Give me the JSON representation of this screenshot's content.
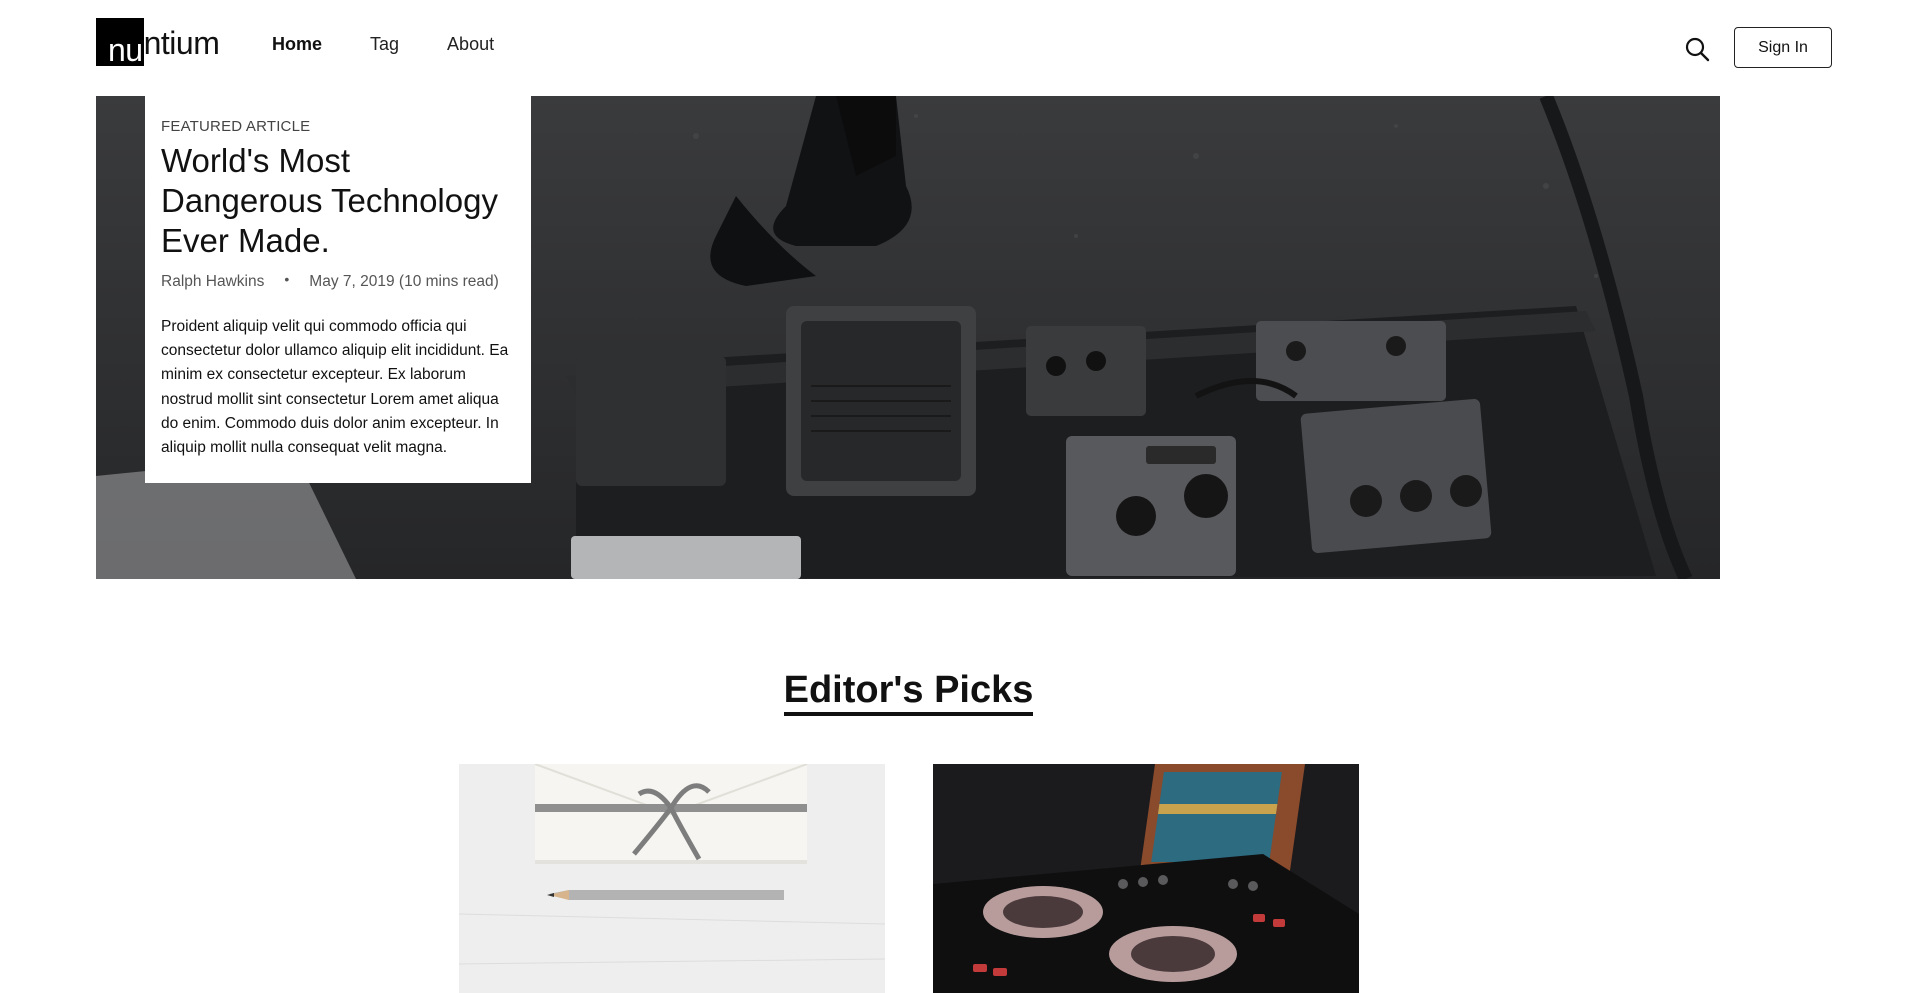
{
  "brand": {
    "logo_highlight": "nu",
    "logo_rest": "ntium"
  },
  "nav": {
    "items": [
      {
        "label": "Home",
        "active": true
      },
      {
        "label": "Tag",
        "active": false
      },
      {
        "label": "About",
        "active": false
      }
    ]
  },
  "header": {
    "signin_label": "Sign In"
  },
  "featured": {
    "tag": "FEATURED ARTICLE",
    "title": "World's Most Dangerous Technology Ever Made.",
    "author": "Ralph Hawkins",
    "separator": "•",
    "date": "May 7, 2019 (10 mins read)",
    "excerpt": "Proident aliquip velit qui commodo officia qui consectetur dolor ullamco aliquip elit incididunt. Ea minim ex consectetur excepteur. Ex laborum nostrud mollit sint consectetur Lorem amet aliqua do enim. Commodo duis dolor anim excepteur. In aliquip mollit nulla consequat velit magna."
  },
  "editors_picks": {
    "title": "Editor's Picks"
  },
  "colors": {
    "accent": "#111111",
    "hero_bg": "#2a2b2d"
  }
}
